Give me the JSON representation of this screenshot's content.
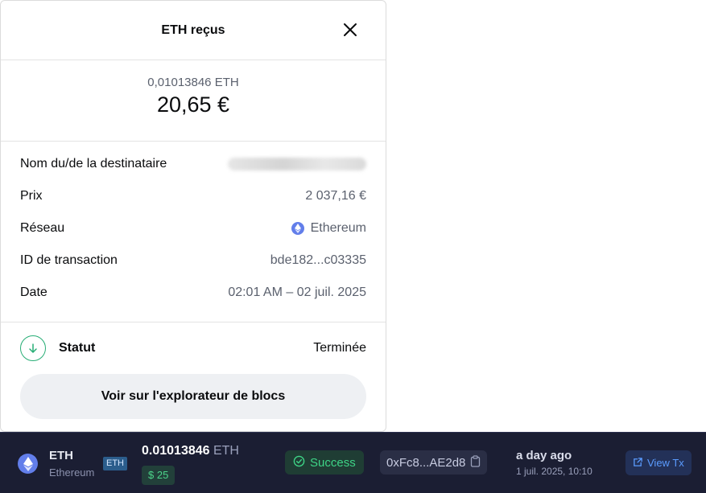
{
  "modal": {
    "title": "ETH reçus",
    "amount_crypto": "0,01013846 ETH",
    "amount_fiat": "20,65 €",
    "details": [
      {
        "key": "recipient",
        "label": "Nom du/de la destinataire",
        "value": ""
      },
      {
        "key": "price",
        "label": "Prix",
        "value": "2 037,16 €"
      },
      {
        "key": "network",
        "label": "Réseau",
        "value": "Ethereum"
      },
      {
        "key": "txid",
        "label": "ID de transaction",
        "value": "bde182...c03335"
      },
      {
        "key": "date",
        "label": "Date",
        "value": "02:01 AM – 02 juil. 2025"
      }
    ],
    "status_label": "Statut",
    "status_value": "Terminée",
    "explorer_button": "Voir sur l'explorateur de blocs"
  },
  "tx_bar": {
    "symbol": "ETH",
    "network": "Ethereum",
    "tag": "ETH",
    "amount": "0.01013846",
    "amount_unit": "ETH",
    "usd_value": "$ 25",
    "status": "Success",
    "address": "0xFc8...AE2d8",
    "time_ago": "a day ago",
    "time_full": "1 juil. 2025, 10:10",
    "view_tx": "View Tx"
  },
  "colors": {
    "eth_brand": "#627eea",
    "success_green": "#3ed486",
    "bar_background": "#1b1e33",
    "link_blue": "#5b9cff"
  },
  "icons": [
    "close-icon",
    "ethereum-icon",
    "arrow-down-icon",
    "check-circle-icon",
    "copy-icon",
    "external-link-icon"
  ]
}
